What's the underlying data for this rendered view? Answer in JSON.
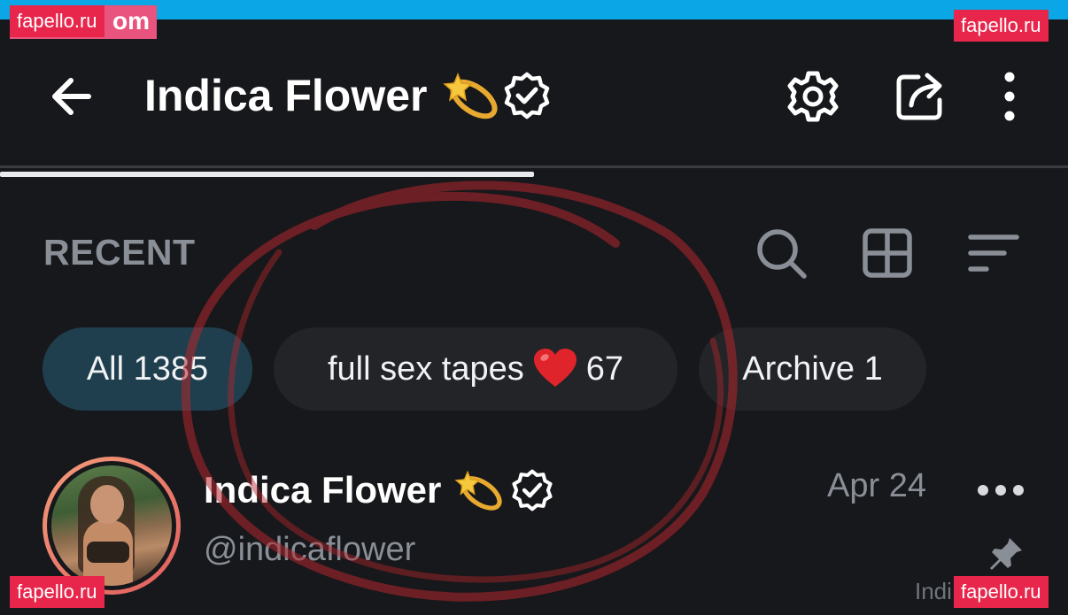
{
  "header": {
    "title": "Indica Flower",
    "back_icon": "arrow-left-icon",
    "star_emoji": "dizzy-star-emoji",
    "verified_icon": "verified-badge-icon",
    "actions": [
      "gear-icon",
      "share-icon",
      "more-vertical-icon"
    ]
  },
  "tabs": {
    "active_index": 0
  },
  "section": {
    "title": "RECENT",
    "tools": [
      "search-icon",
      "grid-icon",
      "sort-icon"
    ]
  },
  "chips": [
    {
      "label": "All 1385",
      "active": true
    },
    {
      "label_before": "full sex tapes",
      "emoji": "red-heart-emoji",
      "label_after": "67",
      "active": false
    },
    {
      "label": "Archive 1",
      "active": false
    }
  ],
  "post": {
    "name": "Indica Flower",
    "handle": "@indicaflower",
    "date": "Apr 24",
    "more_icon": "more-horizontal-icon",
    "pin_icon": "pin-icon",
    "corner_text": "Indi"
  },
  "watermarks": {
    "top_left": "fapello.ru",
    "top_left_under": "om",
    "top_right": "fapello.ru",
    "bottom_left": "fapello.ru",
    "bottom_right": "fapello.ru"
  },
  "colors": {
    "background": "#17181b",
    "top_bar": "#0aa6e6",
    "active_chip": "#1f3f4e",
    "chip": "#222427",
    "muted_text": "#8a8f97",
    "watermark": "#e8254b",
    "scribble": "#b3262c"
  }
}
